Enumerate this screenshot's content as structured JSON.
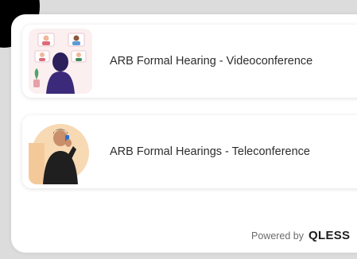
{
  "services": [
    {
      "label": "ARB Formal Hearing - Videoconference",
      "icon": "videoconference-illustration-icon"
    },
    {
      "label": "ARB Formal Hearings - Teleconference",
      "icon": "teleconference-illustration-icon"
    }
  ],
  "footer": {
    "powered_by": "Powered by",
    "brand": "QLESS"
  },
  "colors": {
    "background": "#dcdcdc",
    "card": "#ffffff",
    "text": "#2d2d2d",
    "accent_purple": "#3b2a7a",
    "accent_peach": "#f4c99a"
  }
}
